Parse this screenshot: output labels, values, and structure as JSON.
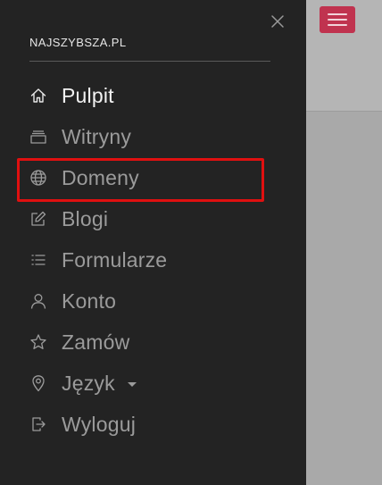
{
  "drawer": {
    "brand": "NAJSZYBSZA.PL",
    "close_icon": "close-icon"
  },
  "header": {
    "menu_toggle_icon": "hamburger-icon",
    "accent_color": "#c0334f"
  },
  "menu": {
    "items": [
      {
        "label": "Pulpit",
        "icon": "home-icon",
        "active": true
      },
      {
        "label": "Witryny",
        "icon": "window-stack-icon",
        "active": false
      },
      {
        "label": "Domeny",
        "icon": "globe-icon",
        "active": false,
        "highlighted": true
      },
      {
        "label": "Blogi",
        "icon": "edit-icon",
        "active": false
      },
      {
        "label": "Formularze",
        "icon": "list-icon",
        "active": false
      },
      {
        "label": "Konto",
        "icon": "user-icon",
        "active": false
      },
      {
        "label": "Zamów",
        "icon": "star-icon",
        "active": false
      },
      {
        "label": "Język",
        "icon": "location-pin-icon",
        "active": false,
        "has_dropdown": true
      },
      {
        "label": "Wyloguj",
        "icon": "logout-icon",
        "active": false
      }
    ]
  },
  "colors": {
    "drawer_bg": "#232323",
    "backdrop": "#a9a9a9",
    "active_text": "#f2f2f2",
    "inactive_text": "#9b9b9b",
    "highlight_border": "#e01010"
  }
}
